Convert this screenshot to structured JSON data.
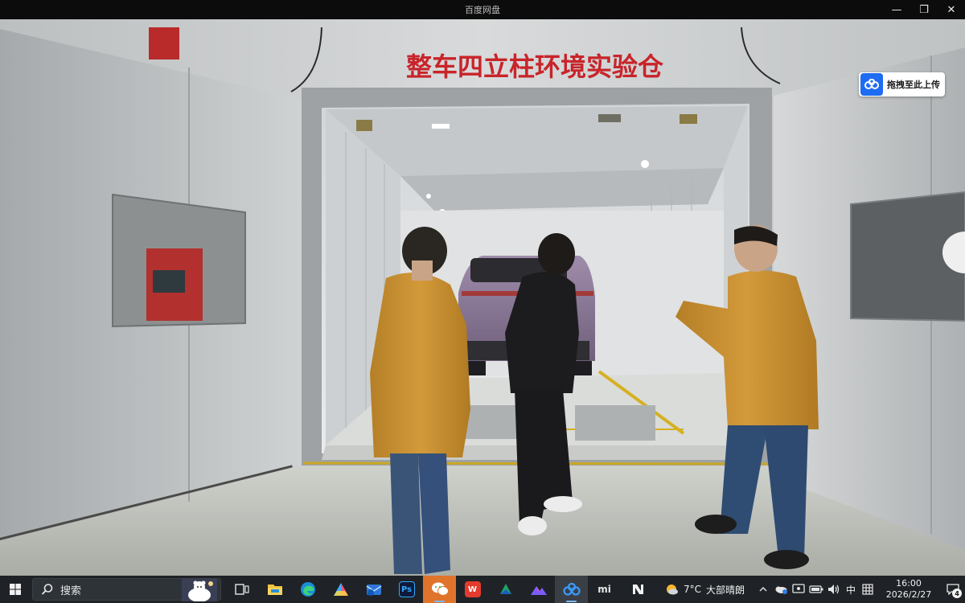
{
  "window": {
    "title": "百度网盘",
    "controls": {
      "minimize": "—",
      "maximize": "❐",
      "close": "✕"
    }
  },
  "video": {
    "scene_sign": "整车四立柱环境实验仓",
    "upload_button_label": "拖拽至此上传",
    "colors": {
      "sign_red": "#c8242a",
      "jacket": "#c9902f",
      "car": "#8b7898",
      "floor": "#b9bcb5"
    }
  },
  "taskbar": {
    "search_label": "搜索",
    "apps": [
      {
        "name": "task-view",
        "icon": "task-view-icon"
      },
      {
        "name": "file-explorer",
        "icon": "folder-icon"
      },
      {
        "name": "edge",
        "icon": "edge-icon"
      },
      {
        "name": "app-a",
        "icon": "triangle-app-icon"
      },
      {
        "name": "mail",
        "icon": "mail-icon"
      },
      {
        "name": "photoshop",
        "icon": "photoshop-icon",
        "label": "Ps"
      },
      {
        "name": "wechat",
        "icon": "wechat-icon"
      },
      {
        "name": "wps",
        "icon": "wps-icon",
        "label": "W"
      },
      {
        "name": "app-green",
        "icon": "green-app-icon"
      },
      {
        "name": "app-mountain",
        "icon": "mountain-app-icon"
      },
      {
        "name": "baidu-netdisk",
        "icon": "baidu-netdisk-icon"
      },
      {
        "name": "xiaomi",
        "icon": "xiaomi-icon",
        "label": "mi"
      },
      {
        "name": "app-n",
        "icon": "n-app-icon"
      }
    ],
    "weather": {
      "temperature": "7°C",
      "condition": "大部晴朗"
    },
    "ime": "中",
    "clock": {
      "time": "16:00",
      "date": "2026/2/27"
    },
    "notifications": "4"
  }
}
